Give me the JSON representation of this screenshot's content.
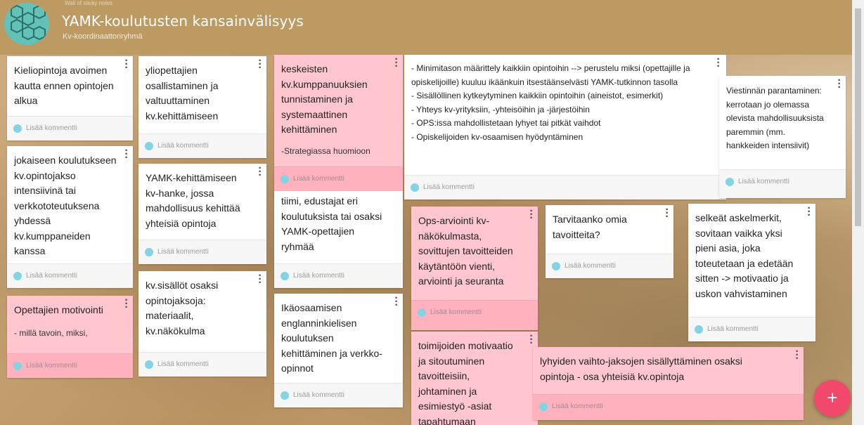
{
  "header": {
    "crumb": "Wall of sticky notes",
    "title": "YAMK-koulutusten kansainvälisyys",
    "subtitle": "Kv-koordinaattoriryhmä"
  },
  "comment_label": "Lisää kommentti",
  "fab_label": "+",
  "colors": {
    "pink_note": "#ffc6cf",
    "white_note": "#ffffff",
    "fab": "#f2486c",
    "header": "#bd9a62"
  },
  "cards": {
    "c1": "Kieliopintoja avoimen\nkautta ennen opintojen\nalkua",
    "c2": "jokaiseen koulutukseen\nkv.opintojakso\nintensiivinä tai\nverkkototeutuksena\nyhdessä\nkv.kumppaneiden\nkanssa",
    "c3_title": "Opettajien motivointi",
    "c3_sub": "- millä tavoin, miksi,",
    "c4": "yliopettajien\nosallistaminen ja\nvaltuuttaminen\nkv.kehittämiseen",
    "c5": "YAMK-kehittämiseen\nkv-hanke, jossa\nmahdollisuus kehittää\nyhteisiä opintoja",
    "c6": "kv.sisällöt osaksi\nopintojaksoja:\nmateriaalit,\nkv.näkökulma",
    "c7_title": "keskeisten\nkv.kumppanuuksien\ntunnistaminen ja\nsystemaattinen\nkehittäminen",
    "c7_sub": "-Strategiassa huomioon",
    "c8": "tiimi, edustajat eri\nkoulutuksista tai osaksi\nYAMK-opettajien\nryhmää",
    "c9": "Ikäosaamisen\nenglanninkielisen\nkoulutuksen\nkehittäminen ja verkko-\nopinnot",
    "c10": "- Minimitason määrittely kaikkiin opintoihin --> perustelu miksi (opettajille ja\nopiskelijoille) kuuluu ikäänkuin itsestäänselvästi YAMK-tutkinnon tasolla\n- Sisällöllinen kytkeytyminen kaikkiin opintoihin (aineistot, esimerkit)\n- Yhteys kv-yrityksiin, -yhteisöihin ja -järjestöihin\n- OPS:issa mahdollistetaan lyhyet tai pitkät vaihdot\n- Opiskelijoiden kv-osaamisen hyödyntäminen",
    "c11": "Ops-arviointi kv-\nnäkökulmasta,\nsovittujen tavoitteiden\nkäytäntöön vienti,\narviointi ja seuranta",
    "c12": "toimijoiden motivaatio\nja sitoutuminen\ntavoitteisiin,\njohtaminen ja\nesimiestyö -asiat\ntapahtumaan",
    "c13": "Tarvitaanko omia\ntavoitteita?",
    "c14": "Viestinnän parantaminen:\nkerrotaan jo olemassa\nolevista mahdollisuuksista\nparemmin (mm.\nhankkeiden intensiivit)",
    "c15": "selkeät askelmerkit,\nsovitaan vaikka yksi\npieni asia, joka\ntoteutetaan ja edetään\nsitten -> motivaatio ja\nuskon vahvistaminen",
    "c16": "lyhyiden vaihto-jaksojen sisällyttäminen osaksi\nopintoja - osa yhteisiä kv.opintoja"
  }
}
